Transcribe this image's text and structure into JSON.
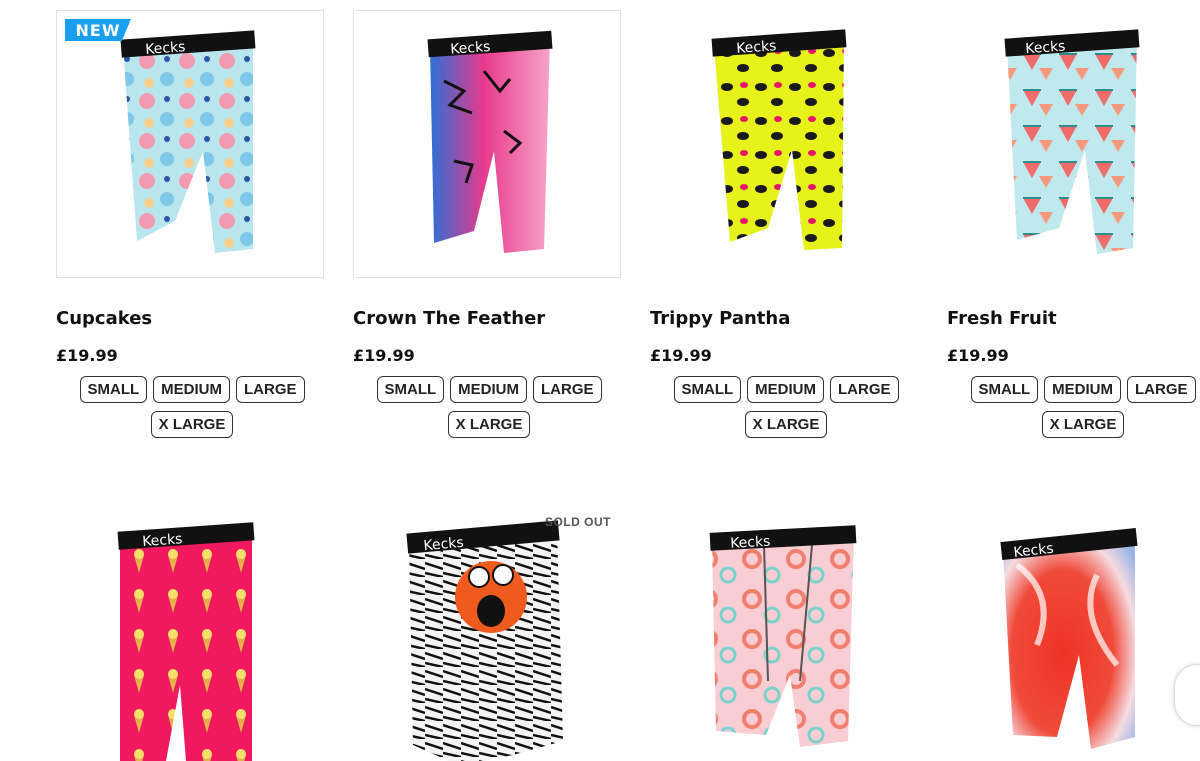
{
  "badges": {
    "new": "NEW",
    "sold_out": "SOLD OUT"
  },
  "products": [
    {
      "title": "Cupcakes",
      "price": "£19.99",
      "sizes": [
        "SMALL",
        "MEDIUM",
        "LARGE",
        "X LARGE"
      ],
      "pattern": "cupcakes"
    },
    {
      "title": "Crown The Feather",
      "price": "£19.99",
      "sizes": [
        "SMALL",
        "MEDIUM",
        "LARGE",
        "X LARGE"
      ],
      "pattern": "feather"
    },
    {
      "title": "Trippy Pantha",
      "price": "£19.99",
      "sizes": [
        "SMALL",
        "MEDIUM",
        "LARGE",
        "X LARGE"
      ],
      "pattern": "leopard"
    },
    {
      "title": "Fresh Fruit",
      "price": "£19.99",
      "sizes": [
        "SMALL",
        "MEDIUM",
        "LARGE",
        "X LARGE"
      ],
      "pattern": "watermelon"
    },
    {
      "pattern": "icecream"
    },
    {
      "pattern": "monster"
    },
    {
      "pattern": "pool"
    },
    {
      "pattern": "marble"
    }
  ],
  "brand": "Kecks",
  "colors": {
    "badge": "#1a9ff0",
    "waistband": "#111111"
  }
}
